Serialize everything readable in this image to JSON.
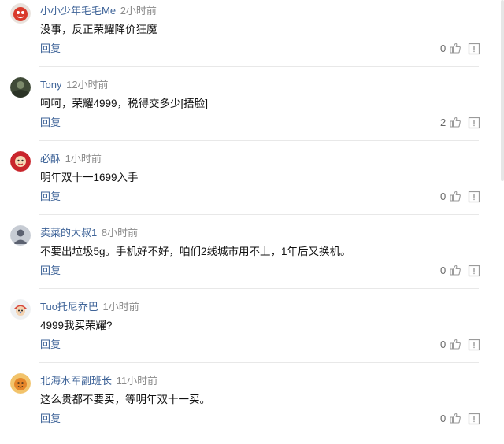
{
  "comments": [
    {
      "username": "小小少年毛毛Me",
      "time": "2小时前",
      "text": "没事，反正荣耀降价狂魔",
      "reply_label": "回复",
      "likes": "0",
      "avatar_icon": "red-round-avatar-icon"
    },
    {
      "username": "Tony",
      "time": "12小时前",
      "text": "呵呵，荣耀4999，税得交多少[捂脸]",
      "reply_label": "回复",
      "likes": "2",
      "avatar_icon": "green-scenery-avatar-icon"
    },
    {
      "username": "必酥",
      "time": "1小时前",
      "text": "明年双十一1699入手",
      "reply_label": "回复",
      "likes": "0",
      "avatar_icon": "red-cartoon-avatar-icon"
    },
    {
      "username": "卖菜的大叔1",
      "time": "8小时前",
      "text": "不要出垃圾5g。手机好不好，咱们2线城市用不上，1年后又换机。",
      "reply_label": "回复",
      "likes": "0",
      "avatar_icon": "person-photo-avatar-icon"
    },
    {
      "username": "Tuo托尼乔巴",
      "time": "1小时前",
      "text": "4999我买荣耀?",
      "reply_label": "回复",
      "likes": "0",
      "avatar_icon": "cartoon-character-avatar-icon"
    },
    {
      "username": "北海水军副班长",
      "time": "11小时前",
      "text": "这么贵都不要买，等明年双十一买。",
      "reply_label": "回复",
      "likes": "0",
      "avatar_icon": "orange-round-avatar-icon"
    }
  ]
}
